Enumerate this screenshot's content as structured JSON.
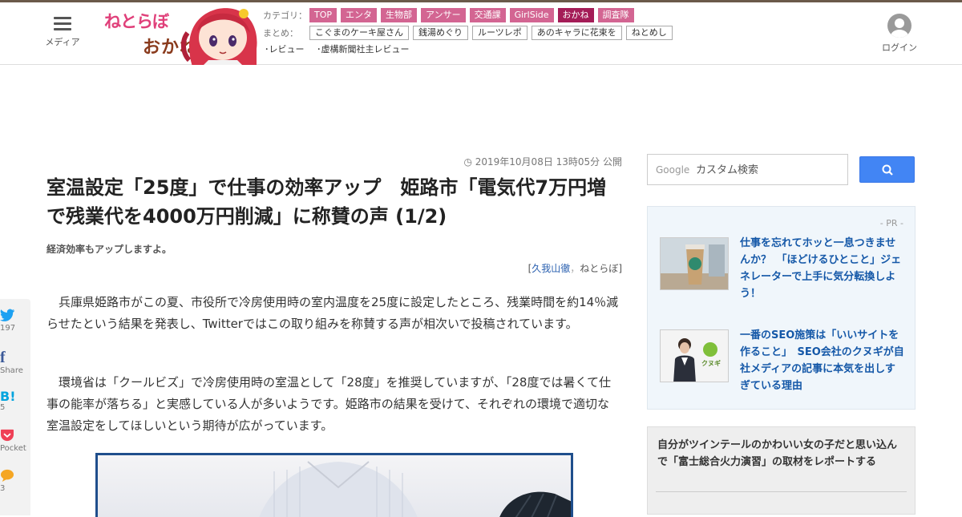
{
  "header": {
    "menu_label": "メディア",
    "logo_text_1": "ねとらぼ",
    "logo_text_2": "おかね",
    "category_label": "カテゴリ：",
    "categories": [
      {
        "label": "TOP",
        "active": false
      },
      {
        "label": "エンタ",
        "active": false
      },
      {
        "label": "生物部",
        "active": false
      },
      {
        "label": "アンサー",
        "active": false
      },
      {
        "label": "交通課",
        "active": false
      },
      {
        "label": "GirlSide",
        "active": false
      },
      {
        "label": "おかね",
        "active": true
      },
      {
        "label": "調査隊",
        "active": false
      }
    ],
    "matome_label": "まとめ：",
    "matome": [
      "こぐまのケーキ屋さん",
      "銭湯めぐり",
      "ルーツレポ",
      "あのキャラに花束を",
      "ねとめし"
    ],
    "reviews": [
      "･レビュー",
      "･虚構新聞社主レビュー"
    ],
    "login_label": "ログイン",
    "accent_color": "#d36592",
    "active_color": "#a41c57"
  },
  "article": {
    "date": "2019年10月08日 13時05分 公開",
    "title": "室温設定「25度」で仕事の効率アップ　姫路市「電気代7万円増で残業代を4000万円削減」に称賛の声 (1/2)",
    "subtitle": "経済効率もアップしますよ。",
    "byline_open": "[",
    "author": "久我山徹",
    "byline_sep": "，",
    "publisher": "ねとらぼ",
    "byline_close": "]",
    "paragraphs": [
      "兵庫県姫路市がこの夏、市役所で冷房使用時の室内温度を25度に設定したところ、残業時間を約14％減らせたという結果を発表し、Twitterではこの取り組みを称賛する声が相次いで投稿されています。",
      "環境省は「クールビズ」で冷房使用時の室温として「28度」を推奨していますが、「28度では暑くて仕事の能率が落ちる」と実感している人が多いようです。姫路市の結果を受けて、それぞれの環境で適切な室温設定をしてほしいという期待が広がっています。"
    ]
  },
  "share": [
    {
      "icon": "twitter-icon",
      "glyph": "🐦",
      "count": "197",
      "color": "#1da1f2"
    },
    {
      "icon": "facebook-icon",
      "glyph": "f",
      "count": "Share",
      "color": "#3b5998"
    },
    {
      "icon": "hatena-icon",
      "glyph": "B!",
      "count": "5",
      "color": "#00a4de"
    },
    {
      "icon": "pocket-icon",
      "glyph": "⛉",
      "count": "Pocket",
      "color": "#ef4056"
    },
    {
      "icon": "comment-icon",
      "glyph": "💬",
      "count": "3",
      "color": "#f5a623"
    }
  ],
  "sidebar": {
    "search_brand": "Google",
    "search_placeholder": "カスタム検索",
    "pr_label": "- PR -",
    "pr_items": [
      "仕事を忘れてホッと一息つきませんか？　「ほどけるひとこと」ジェネレーターで上手に気分転換しよう！",
      "一番のSEO施策は「いいサイトを作ること」　SEO会社のクヌギが自社メディアの記事に本気を出しすぎている理由"
    ],
    "pr2_logo_text": "クヌギ",
    "ranking_item": "自分がツインテールのかわいい女の子だと思い込んで「富士総合火力演習」の取材をレポートする"
  }
}
